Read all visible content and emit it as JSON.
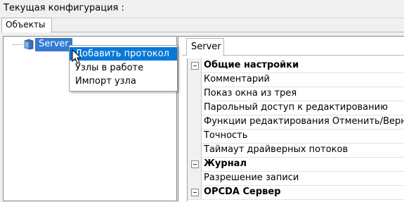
{
  "header": {
    "title": "Текущая конфигурация :"
  },
  "left_tab": {
    "label": "Объекты"
  },
  "tree": {
    "node_label": "Server"
  },
  "context_menu": {
    "items": [
      "Добавить протокол",
      "Узлы в работе",
      "Импорт узла"
    ],
    "highlighted_index": 0
  },
  "right_tab": {
    "label": "Server"
  },
  "property_grid": {
    "rows": [
      {
        "label": "Общие настройки",
        "category": true
      },
      {
        "label": "Комментарий",
        "category": false
      },
      {
        "label": "Показ окна из трея",
        "category": false
      },
      {
        "label": "Парольный доступ к редактированию",
        "category": false
      },
      {
        "label": "Функции редактирования Отменить/Верну",
        "category": false
      },
      {
        "label": "Точность",
        "category": false
      },
      {
        "label": "Таймаут драйверных потоков",
        "category": false
      },
      {
        "label": "Журнал",
        "category": true
      },
      {
        "label": "Разрешение записи",
        "category": false
      },
      {
        "label": "OPCDA Сервер",
        "category": true
      }
    ]
  },
  "colors": {
    "selection": "#0a78d7",
    "node_selected": "#2f7bd7",
    "panel_bg": "#f0f0f0"
  },
  "icons": {
    "tree_node": "server-icon",
    "cursor": "mouse-pointer-icon",
    "category_toggle": "collapse-minus-icon"
  }
}
